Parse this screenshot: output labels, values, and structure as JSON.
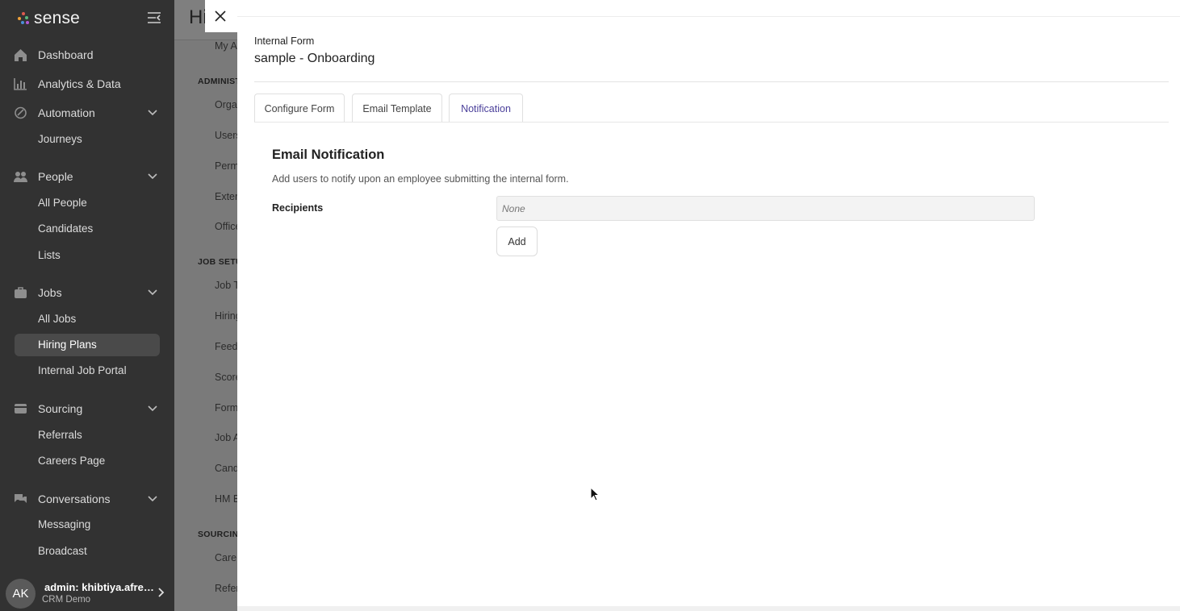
{
  "brand": {
    "name": "sense",
    "dot_colors": [
      "#e05a4e",
      "#f0a23a",
      "#5ab87a",
      "#4a8fd8",
      "#b25ad8"
    ]
  },
  "sidebar": {
    "groups": [
      {
        "label": "Dashboard",
        "icon": "home-icon"
      },
      {
        "label": "Analytics & Data",
        "icon": "bar-chart-icon"
      },
      {
        "label": "Automation",
        "icon": "rocket-icon",
        "items": [
          "Journeys"
        ]
      },
      {
        "label": "People",
        "icon": "people-icon",
        "items": [
          "All People",
          "Candidates",
          "Lists"
        ]
      },
      {
        "label": "Jobs",
        "icon": "briefcase-icon",
        "items": [
          "All Jobs",
          "Hiring Plans",
          "Internal Job Portal"
        ]
      },
      {
        "label": "Sourcing",
        "icon": "sourcing-card-icon",
        "items": [
          "Referrals",
          "Careers Page"
        ]
      },
      {
        "label": "Conversations",
        "icon": "chat-icon",
        "items": [
          "Messaging",
          "Broadcast"
        ]
      }
    ],
    "active_item": "Hiring Plans",
    "user": {
      "initials": "AK",
      "name": "admin: khibtiya.afree...",
      "org": "CRM Demo"
    }
  },
  "background_page": {
    "title": "Hi",
    "sections": [
      "ADMINIST",
      "JOB SETU",
      "SOURCING"
    ],
    "links": [
      "My A",
      "Orga",
      "Users",
      "Perm",
      "Exter",
      "Office",
      "Job T",
      "Hiring",
      "Feed",
      "Score",
      "Form",
      "Job A",
      "Cand",
      "HM E",
      "Care",
      "Refer"
    ]
  },
  "drawer": {
    "form_type": "Internal Form",
    "form_name": "sample - Onboarding",
    "tabs": [
      "Configure Form",
      "Email Template",
      "Notification"
    ],
    "active_tab": "Notification",
    "section_title": "Email Notification",
    "section_description": "Add users to notify upon an employee submitting the internal form.",
    "recipients_label": "Recipients",
    "recipients_value": "None",
    "add_button": "Add"
  },
  "colors": {
    "sidebar_bg": "#323232",
    "accent_tab": "#4a3f9a",
    "overlay": "#7a7a7a"
  }
}
